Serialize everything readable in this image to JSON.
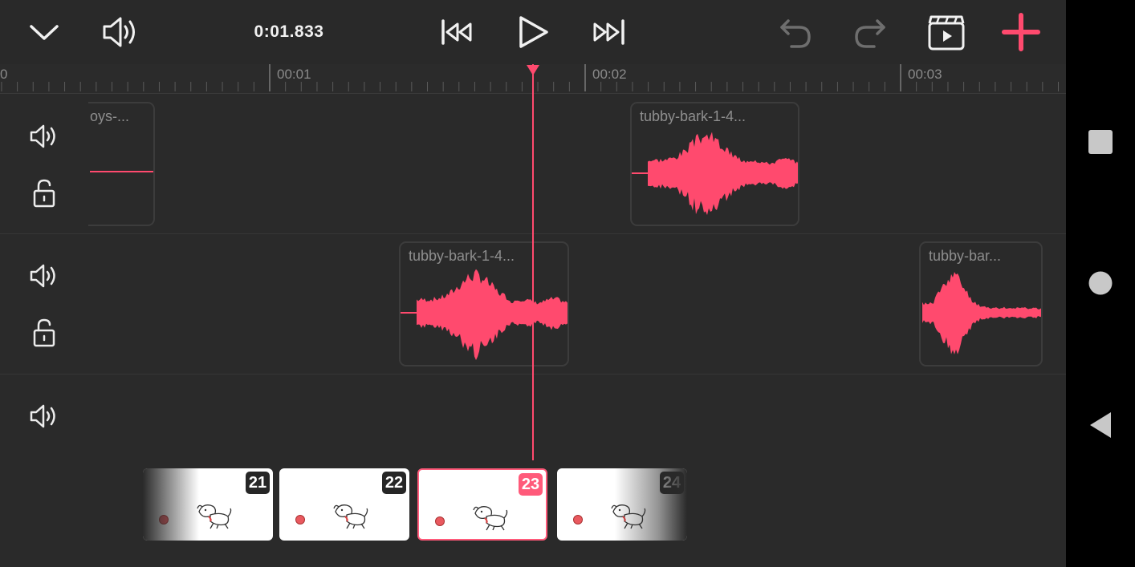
{
  "toolbar": {
    "time": "0:01.833",
    "icons": [
      "chevron-down-icon",
      "volume-icon",
      "skip-to-start-icon",
      "play-icon",
      "skip-to-end-icon",
      "undo-icon",
      "redo-icon",
      "clapperboard-icon",
      "add-icon"
    ],
    "accent": "#ff4a6e"
  },
  "ruler": {
    "labels": [
      "0",
      "00:01",
      "00:02",
      "00:03"
    ]
  },
  "tracks": [
    {
      "clips": [
        {
          "name": "oys-..."
        },
        {
          "name": "tubby-bark-1-4..."
        }
      ]
    },
    {
      "clips": [
        {
          "name": "tubby-bark-1-4..."
        },
        {
          "name": "tubby-bar..."
        }
      ]
    },
    {
      "clips": []
    }
  ],
  "frames": [
    {
      "number": "21",
      "selected": false
    },
    {
      "number": "22",
      "selected": false
    },
    {
      "number": "23",
      "selected": true
    },
    {
      "number": "24",
      "selected": false
    }
  ],
  "system_nav": [
    "square-recents-icon",
    "circle-home-icon",
    "triangle-back-icon"
  ]
}
